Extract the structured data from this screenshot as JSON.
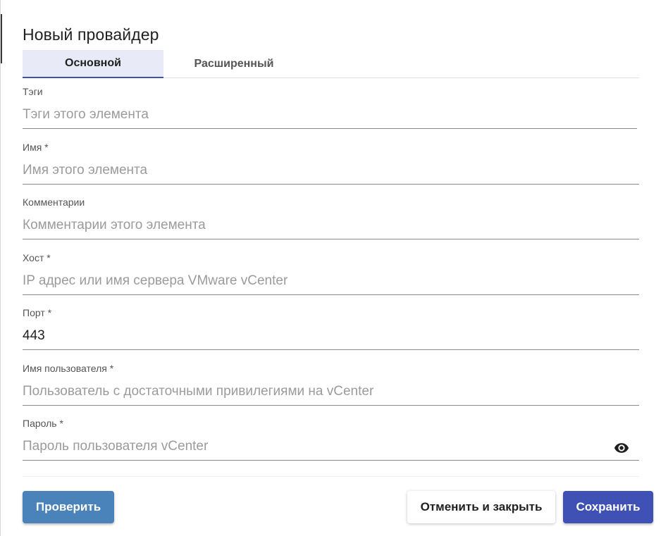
{
  "dialog": {
    "title": "Новый провайдер"
  },
  "tabs": [
    {
      "label": "Основной",
      "active": true
    },
    {
      "label": "Расширенный",
      "active": false
    }
  ],
  "fields": {
    "tags": {
      "label": "Тэги",
      "placeholder": "Тэги этого элемента",
      "value": ""
    },
    "name": {
      "label": "Имя *",
      "placeholder": "Имя этого элемента",
      "value": ""
    },
    "comments": {
      "label": "Комментарии",
      "placeholder": "Комментарии этого элемента",
      "value": ""
    },
    "host": {
      "label": "Хост *",
      "placeholder": "IP адрес или имя сервера VMware vCenter",
      "value": ""
    },
    "port": {
      "label": "Порт *",
      "placeholder": "",
      "value": "443"
    },
    "username": {
      "label": "Имя пользователя *",
      "placeholder": "Пользователь с достаточными привилегиями на vCenter",
      "value": ""
    },
    "password": {
      "label": "Пароль *",
      "placeholder": "Пароль пользователя vCenter",
      "value": "",
      "toggle_icon": "eye-icon"
    }
  },
  "buttons": {
    "test": "Проверить",
    "cancel": "Отменить и закрыть",
    "save": "Сохранить"
  },
  "colors": {
    "primary": "#3f51b5",
    "test_button": "#4a83b9",
    "active_tab_bg": "#e8ebf7"
  }
}
